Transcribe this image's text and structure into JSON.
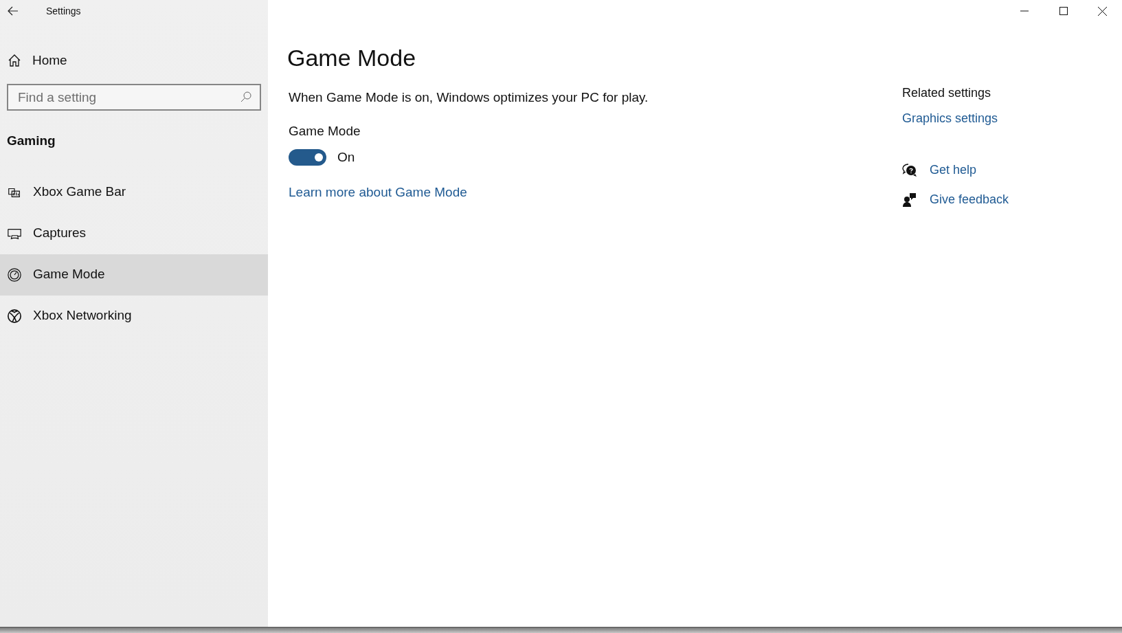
{
  "window": {
    "title": "Settings"
  },
  "sidebar": {
    "home": "Home",
    "search": {
      "placeholder": "Find a setting"
    },
    "section": "Gaming",
    "items": [
      {
        "label": "Xbox Game Bar",
        "kind": "gamebar",
        "selected": false
      },
      {
        "label": "Captures",
        "kind": "captures",
        "selected": false
      },
      {
        "label": "Game Mode",
        "kind": "gamemode",
        "selected": true
      },
      {
        "label": "Xbox Networking",
        "kind": "xbox",
        "selected": false
      }
    ]
  },
  "page": {
    "title": "Game Mode",
    "description": "When Game Mode is on, Windows optimizes your PC for play.",
    "toggle": {
      "label": "Game Mode",
      "on": true,
      "state_text": "On"
    },
    "link": "Learn more about Game Mode"
  },
  "related": {
    "heading": "Related settings",
    "links": [
      "Graphics settings"
    ]
  },
  "support": [
    {
      "kind": "help",
      "label": "Get help"
    },
    {
      "kind": "feedback",
      "label": "Give feedback"
    }
  ]
}
